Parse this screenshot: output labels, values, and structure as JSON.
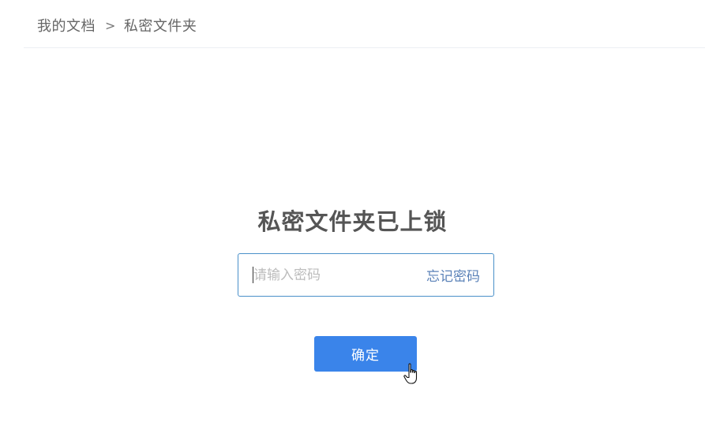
{
  "breadcrumb": {
    "root": "我的文档",
    "separator": ">",
    "current": "私密文件夹"
  },
  "lock_screen": {
    "title": "私密文件夹已上锁",
    "password_placeholder": "请输入密码",
    "password_value": "",
    "forgot_label": "忘记密码",
    "confirm_label": "确定"
  },
  "colors": {
    "accent": "#3a84ea",
    "link": "#5b82b8",
    "input_border": "#4a90c9"
  },
  "icons": {
    "cursor": "hand-pointer-icon"
  }
}
